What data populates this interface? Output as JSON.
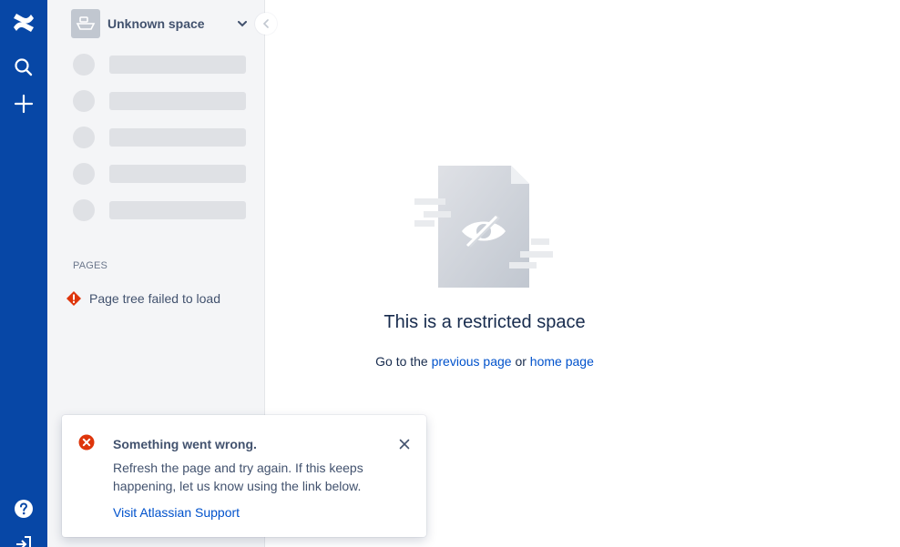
{
  "colors": {
    "rail_bg": "#0747a6",
    "sidebar_bg": "#f4f5f7",
    "skeleton": "#dfe1e5",
    "link": "#0052cc",
    "error_red": "#de350b",
    "text_primary": "#172b4d",
    "text_secondary": "#42526e"
  },
  "nav": {
    "logo_icon": "confluence-logo-icon",
    "search_icon": "search-icon",
    "create_icon": "plus-icon",
    "help_icon": "help-icon",
    "login_icon": "sign-in-icon"
  },
  "sidebar": {
    "space_name": "Unknown space",
    "pages_heading": "PAGES",
    "tree_error": "Page tree failed to load"
  },
  "main": {
    "title": "This is a restricted space",
    "sub_prefix": "Go to the",
    "previous_link": "previous page",
    "sub_joiner": "or",
    "home_link": "home page"
  },
  "flag": {
    "title": "Something went wrong.",
    "body": "Refresh the page and try again. If this keeps happening, let us know using the link below.",
    "link": "Visit Atlassian Support"
  }
}
